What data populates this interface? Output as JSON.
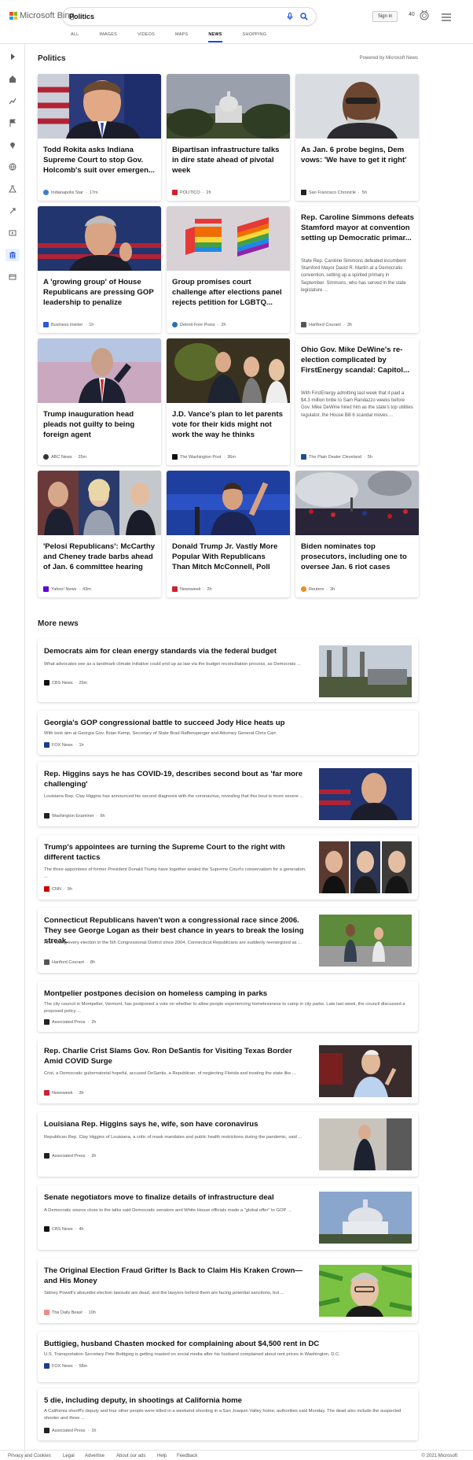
{
  "header": {
    "brand": "Microsoft Bing",
    "query": "Politics",
    "sign_in": "Sign in",
    "points": "40",
    "tabs": [
      "ALL",
      "IMAGES",
      "VIDEOS",
      "MAPS",
      "NEWS",
      "SHOPPING"
    ]
  },
  "section_title": "Politics",
  "powered_by": "Powered by Microsoft News",
  "cards": [
    {
      "title": "Todd Rokita asks Indiana Supreme Court to stop Gov. Holcomb's suit over emergen...",
      "source": "Indianapolis Star",
      "age": "17m",
      "color": "#3b7dd8"
    },
    {
      "title": "Bipartisan infrastructure talks in dire state ahead of pivotal week",
      "source": "POLITICO",
      "age": "2h",
      "color": "#d3202e"
    },
    {
      "title": "As Jan. 6 probe begins, Dem vows: 'We have to get it right'",
      "source": "San Francisco Chronicle",
      "age": "5h",
      "color": "#222222"
    },
    {
      "title": "A 'growing group' of House Republicans are pressing GOP leadership to penalize Cheney...",
      "source": "Business Insider",
      "age": "1h",
      "color": "#2a5bd7"
    },
    {
      "title": "Group promises court challenge after elections panel rejects petition for LGBTQ...",
      "source": "Detroit Free Press",
      "age": "2h",
      "color": "#2c6fb7"
    },
    {
      "title": "Rep. Caroline Simmons defeats Stamford mayor at convention setting up Democratic primar...",
      "snippet": "State Rep. Caroline Simmons defeated incumbent Stamford Mayor David R. Martin at a Democratic convention, setting up a spirited primary in September. Simmons, who has served in the state legislature ...",
      "source": "Hartford Courant",
      "age": "3h",
      "color": "#555555"
    },
    {
      "title": "Trump inauguration head pleads not guilty to being foreign agent",
      "source": "ABC News",
      "age": "25m",
      "color": "#333333"
    },
    {
      "title": "J.D. Vance's plan to let parents vote for their kids might not work the way he thinks",
      "source": "The Washington Post",
      "age": "36m",
      "color": "#111111"
    },
    {
      "title": "Ohio Gov. Mike DeWine's re-election complicated by FirstEnergy scandal: Capitol...",
      "snippet": "With FirstEnergy admitting last week that it paid a $4.3 million bribe to Sam Randazzo weeks before Gov. Mike DeWine hired him as the state's top utilities regulator, the House Bill 6 scandal moves ...",
      "source": "The Plain Dealer Cleveland",
      "age": "5h",
      "color": "#1f4e8c"
    },
    {
      "title": "'Pelosi Republicans': McCarthy and Cheney trade barbs ahead of Jan. 6 committee hearing",
      "source": "Yahoo! News",
      "age": "43m",
      "color": "#6001d2"
    },
    {
      "title": "Donald Trump Jr. Vastly More Popular With Republicans Than Mitch McConnell, Poll Shows",
      "source": "Newsweek",
      "age": "2h",
      "color": "#d1202f"
    },
    {
      "title": "Biden nominates top prosecutors, including one to oversee Jan. 6 riot cases",
      "source": "Reuters",
      "age": "3h",
      "color": "#f08a24"
    }
  ],
  "more_title": "More news",
  "more": [
    {
      "title": "Democrats aim for clean energy standards via the federal budget",
      "snippet": "What advocates see as a landmark climate initiative could end up as law via the budget reconciliation process, as Democrats ...",
      "source": "CBS News",
      "age": "25m",
      "color": "#111111"
    },
    {
      "title": "Georgia's GOP congressional battle to succeed Jody Hice heats up",
      "snippet": "With took aim at Georgia Gov. Brian Kemp, Secretary of State Brad Raffensperger and Attorney General Chris Carr.",
      "source": "FOX News",
      "age": "1h",
      "color": "#1b3c8f"
    },
    {
      "title": "Rep. Higgins says he has COVID-19, describes second bout as 'far more challenging'",
      "snippet": "Louisiana Rep. Clay Higgins has announced his second diagnosis with the coronavirus, revealing that this bout is more severe ...",
      "source": "Washington Examiner",
      "age": "6h",
      "color": "#222222"
    },
    {
      "title": "Trump's appointees are turning the Supreme Court to the right with different tactics",
      "snippet": "The three appointees of former President Donald Trump have together sealed the Supreme Court's conservatism for a generation, ...",
      "source": "CNN",
      "age": "9h",
      "color": "#cc0000"
    },
    {
      "title": "Connecticut Republicans haven't won a congressional race since 2006. They see George Logan as their best chance in years to break the losing streak.",
      "snippet": "After losing every election in the 5th Congressional District since 2004, Connecticut Republicans are suddenly reenergized as ...",
      "source": "Hartford Courant",
      "age": "8h",
      "color": "#555555"
    },
    {
      "title": "Montpelier postpones decision on homeless camping in parks",
      "snippet": "The city council in Montpelier, Vermont, has postponed a vote on whether to allow people experiencing homelessness to camp in city parks. Late last week, the council discussed a proposed policy ...",
      "source": "Associated Press",
      "age": "2h",
      "color": "#222222"
    },
    {
      "title": "Rep. Charlie Crist Slams Gov. Ron DeSantis for Visiting Texas Border Amid COVID Surge",
      "snippet": "Crist, a Democratic gubernatorial hopeful, accused DeSantis, a Republican, of neglecting Florida and treating the state like ...",
      "source": "Newsweek",
      "age": "3h",
      "color": "#d1202f"
    },
    {
      "title": "Louisiana Rep. Higgins says he, wife, son have coronavirus",
      "snippet": "Republican Rep. Clay Higgins of Louisiana, a critic of mask mandates and public health restrictions during the pandemic, said ...",
      "source": "Associated Press",
      "age": "2h",
      "color": "#222222"
    },
    {
      "title": "Senate negotiators move to finalize details of infrastructure deal",
      "snippet": "A Democratic source close to the talks said Democratic senators and White House officials made a \"global offer\" to GOP ...",
      "source": "CBS News",
      "age": "4h",
      "color": "#111111"
    },
    {
      "title": "The Original Election Fraud Grifter Is Back to Claim His Kraken Crown—and His Money",
      "snippet": "Sidney Powell's absurdist election lawsuits are dead, and the lawyers behind them are facing potential sanctions, but ...",
      "source": "The Daily Beast",
      "age": "10h",
      "color": "#f28b82"
    },
    {
      "title": "Buttigieg, husband Chasten mocked for complaining about $4,500 rent in DC",
      "snippet": "U.S. Transportation Secretary Pete Buttigieg is getting roasted on social media after his husband complained about rent prices in Washington, D.C.",
      "source": "FOX News",
      "age": "58m",
      "color": "#1b3c8f"
    },
    {
      "title": "5 die, including deputy, in shootings at California home",
      "snippet": "A California sheriff's deputy and four other people were killed in a weekend shooting in a San Joaquin Valley home, authorities said Monday. The dead also include the suspected shooter and three ...",
      "source": "Associated Press",
      "age": "1h",
      "color": "#222222"
    }
  ],
  "footer": {
    "links": [
      "Privacy and Cookies",
      "Legal",
      "Advertise",
      "About our ads",
      "Help",
      "Feedback"
    ],
    "copyright": "© 2021 Microsoft"
  }
}
